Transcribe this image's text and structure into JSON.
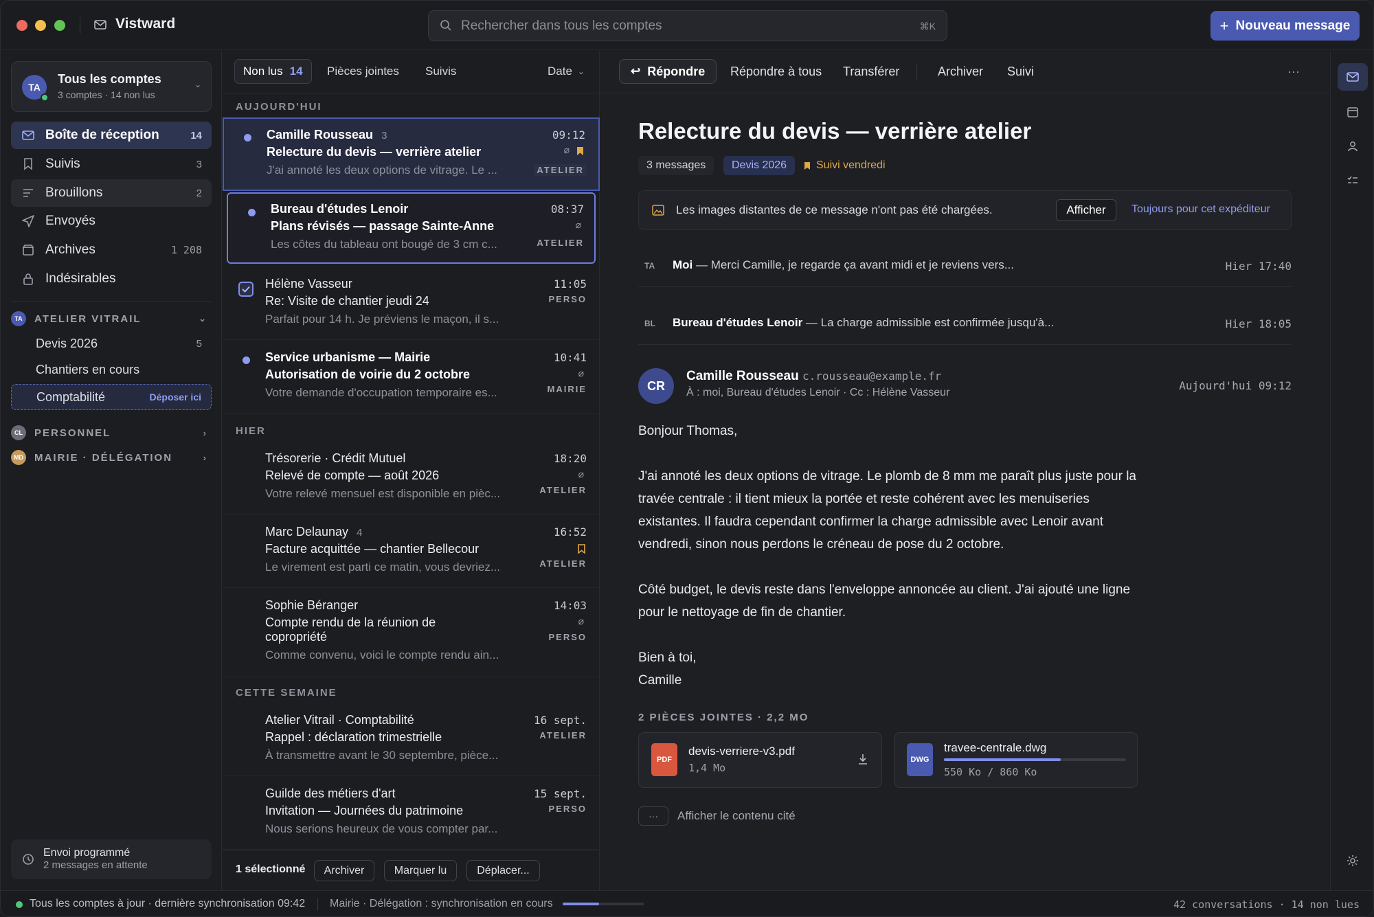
{
  "app": {
    "name": "Vistward"
  },
  "search": {
    "placeholder": "Rechercher dans tous les comptes",
    "shortcut": "⌘K"
  },
  "new_message_label": "Nouveau message",
  "account": {
    "initials": "TA",
    "name": "Tous les comptes",
    "summary": "3 comptes · 14 non lus"
  },
  "nav": [
    {
      "label": "Boîte de réception",
      "count": "14",
      "icon": "inbox-icon"
    },
    {
      "label": "Suivis",
      "count": "3",
      "icon": "bookmark-icon"
    },
    {
      "label": "Brouillons",
      "count": "2",
      "icon": "draft-icon"
    },
    {
      "label": "Envoyés",
      "count": "",
      "icon": "send-icon"
    },
    {
      "label": "Archives",
      "count": "1 208",
      "icon": "archive-icon"
    },
    {
      "label": "Indésirables",
      "count": "",
      "icon": "lock-icon"
    }
  ],
  "sections": {
    "atelier": {
      "initials": "TA",
      "label": "ATELIER VITRAIL",
      "color": "#4a5ab0"
    },
    "personnel": {
      "initials": "CL",
      "label": "PERSONNEL",
      "color": "#6a6d78"
    },
    "mairie": {
      "initials": "MD",
      "label": "MAIRIE · DÉLÉGATION",
      "color": "#c59a5a"
    }
  },
  "folders": [
    {
      "label": "Devis 2026",
      "count": "5"
    },
    {
      "label": "Chantiers en cours",
      "count": ""
    },
    {
      "label": "Comptabilité",
      "drop_label": "Déposer ici"
    }
  ],
  "scheduled": {
    "title": "Envoi programmé",
    "subtitle": "2 messages en attente"
  },
  "list_tabs": {
    "unread": "Non lus",
    "unread_count": "14",
    "attachments": "Pièces jointes",
    "followed": "Suivis",
    "sort": "Date"
  },
  "groups": {
    "today": "AUJOURD'HUI",
    "yesterday": "HIER",
    "week": "CETTE SEMAINE"
  },
  "messages": [
    {
      "from": "Camille Rousseau",
      "thread_count": "3",
      "subject": "Relecture du devis — verrière atelier",
      "preview": "J'ai annoté les deux options de vitrage. Le ...",
      "time": "09:12",
      "tag": "ATELIER"
    },
    {
      "from": "Bureau d'études Lenoir",
      "thread_count": "",
      "subject": "Plans révisés — passage Sainte-Anne",
      "preview": "Les côtes du tableau ont bougé de 3 cm c...",
      "time": "08:37",
      "tag": "ATELIER"
    },
    {
      "from": "Hélène Vasseur",
      "thread_count": "",
      "subject": "Re: Visite de chantier jeudi 24",
      "preview": "Parfait pour 14 h. Je préviens le maçon, il s...",
      "time": "11:05",
      "tag": "PERSO"
    },
    {
      "from": "Service urbanisme — Mairie",
      "thread_count": "",
      "subject": "Autorisation de voirie du 2 octobre",
      "preview": "Votre demande d'occupation temporaire es...",
      "time": "10:41",
      "tag": "MAIRIE"
    },
    {
      "from": "Trésorerie · Crédit Mutuel",
      "thread_count": "",
      "subject": "Relevé de compte — août 2026",
      "preview": "Votre relevé mensuel est disponible en pièc...",
      "time": "18:20",
      "tag": "ATELIER"
    },
    {
      "from": "Marc Delaunay",
      "thread_count": "4",
      "subject": "Facture acquittée — chantier Bellecour",
      "preview": "Le virement est parti ce matin, vous devriez...",
      "time": "16:52",
      "tag": "ATELIER"
    },
    {
      "from": "Sophie Béranger",
      "thread_count": "",
      "subject": "Compte rendu de la réunion de copropriété",
      "preview": "Comme convenu, voici le compte rendu ain...",
      "time": "14:03",
      "tag": "PERSO"
    },
    {
      "from": "Atelier Vitrail · Comptabilité",
      "thread_count": "",
      "subject": "Rappel : déclaration trimestrielle",
      "preview": "À transmettre avant le 30 septembre, pièce...",
      "time": "16 sept.",
      "tag": "ATELIER"
    },
    {
      "from": "Guilde des métiers d'art",
      "thread_count": "",
      "subject": "Invitation — Journées du patrimoine",
      "preview": "Nous serions heureux de vous compter par...",
      "time": "15 sept.",
      "tag": "PERSO"
    }
  ],
  "bulk": {
    "selected": "1 sélectionné",
    "archive": "Archiver",
    "mark_read": "Marquer lu",
    "move": "Déplacer..."
  },
  "toolbar": {
    "reply": "Répondre",
    "reply_all": "Répondre à tous",
    "forward": "Transférer",
    "archive": "Archiver",
    "follow": "Suivi",
    "more": "···"
  },
  "reader": {
    "subject": "Relecture du devis — verrière atelier",
    "chips": {
      "count": "3 messages",
      "label": "Devis 2026",
      "follow": "Suivi vendredi"
    },
    "images_notice": "Les images distantes de ce message n'ont pas été chargées.",
    "show_button": "Afficher",
    "always_link": "Toujours pour cet expéditeur",
    "thread": [
      {
        "initials": "TA",
        "sender": "Moi",
        "excerpt": " — Merci Camille, je regarde ça avant midi et je reviens vers...",
        "date": "Hier 17:40"
      },
      {
        "initials": "BL",
        "sender": "Bureau d'études Lenoir",
        "excerpt": " — La charge admissible est confirmée jusqu'à...",
        "date": "Hier 18:05"
      }
    ],
    "sender": {
      "initials": "CR",
      "name": "Camille Rousseau",
      "email": "c.rousseau@example.fr",
      "recipients": "À : moi, Bureau d'études Lenoir · Cc : Hélène Vasseur",
      "date": "Aujourd'hui 09:12"
    },
    "body": {
      "greeting": "Bonjour Thomas,",
      "p1": "J'ai annoté les deux options de vitrage. Le plomb de 8 mm me paraît plus juste pour la travée centrale : il tient mieux la portée et reste cohérent avec les menuiseries existantes. Il faudra cependant confirmer la charge admissible avec Lenoir avant vendredi, sinon nous perdons le créneau de pose du 2 octobre.",
      "p2": "Côté budget, le devis reste dans l'enveloppe annoncée au client. J'ai ajouté une ligne pour le nettoyage de fin de chantier.",
      "closing": "Bien à toi,",
      "signature": "Camille"
    },
    "attachments_title": "2 PIÈCES JOINTES · 2,2 MO",
    "attachments": [
      {
        "type": "PDF",
        "name": "devis-verriere-v3.pdf",
        "size": "1,4 Mo"
      },
      {
        "type": "DWG",
        "name": "travee-centrale.dwg",
        "size": "550 Ko / 860 Ko",
        "progress": 0.64
      }
    ],
    "quoted_toggle": "···",
    "quoted_label": "Afficher le contenu cité"
  },
  "status": {
    "sync": "Tous les comptes à jour · dernière synchronisation 09:42",
    "mairie": "Mairie · Délégation : synchronisation en cours",
    "mairie_progress": 0.45,
    "summary": "42 conversations · 14 non lues"
  },
  "colors": {
    "accent": "#4a5ab0",
    "unread_dot": "#8d9bf0",
    "follow": "#e0a847",
    "pdf": "#d9573f",
    "dwg": "#4a5ab0",
    "online": "#4cc97a"
  }
}
